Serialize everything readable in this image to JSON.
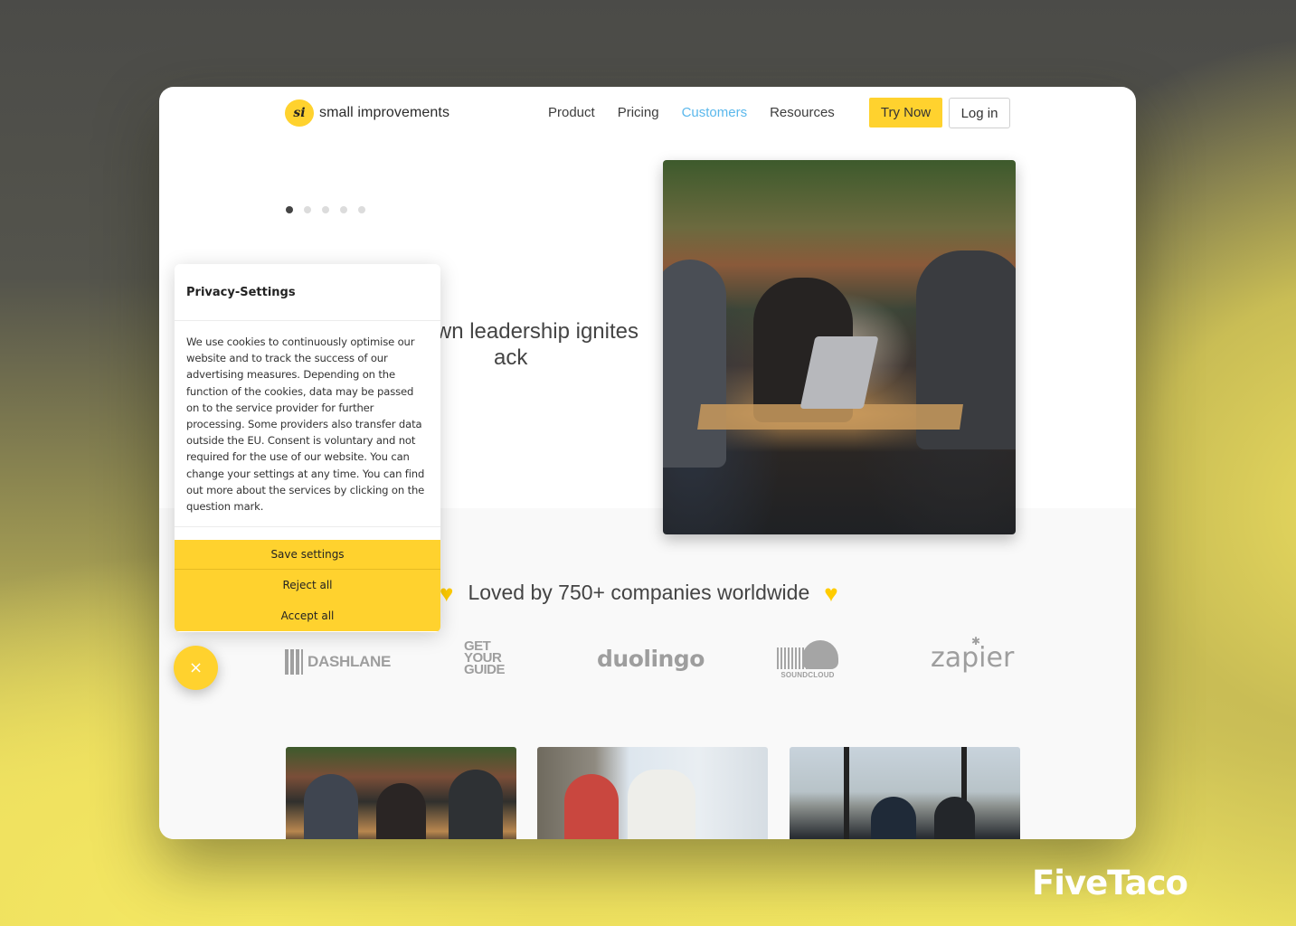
{
  "header": {
    "logo_mark": "si",
    "logo_text": "small improvements",
    "nav": [
      {
        "label": "Product",
        "active": false
      },
      {
        "label": "Pricing",
        "active": false
      },
      {
        "label": "Customers",
        "active": true
      },
      {
        "label": "Resources",
        "active": false
      }
    ],
    "try_now_label": "Try Now",
    "login_label": "Log in"
  },
  "carousel": {
    "slide_count": 5,
    "active_index": 0
  },
  "hero": {
    "headline_line1": "wn leadership ignites",
    "headline_line2": "ack",
    "image_icon": "photo-team-at-cafe-table"
  },
  "social_proof": {
    "heading": "Loved by 750+ companies worldwide",
    "heart_icon": "heart-icon",
    "logos": [
      {
        "name": "DASHLANE"
      },
      {
        "name": "GET YOUR GUIDE",
        "lines": [
          "GET",
          "YOUR",
          "GUIDE"
        ]
      },
      {
        "name": "duolingo"
      },
      {
        "name": "SOUNDCLOUD"
      },
      {
        "name": "zapier"
      }
    ]
  },
  "cards": [
    {
      "image": "team-at-cafe-photo"
    },
    {
      "image": "two-men-laughing-photo"
    },
    {
      "image": "city-skyline-office-photo"
    }
  ],
  "privacy": {
    "title": "Privacy-Settings",
    "body": "We use cookies to continuously optimise our website and to track the success of our advertising measures. Depending on the function of the cookies, data may be passed on to the service provider for further processing. Some providers also transfer data outside the EU. Consent is voluntary and not required for the use of our website. You can change your settings at any time. You can find out more about the services by clicking on the question mark.",
    "save_label": "Save settings",
    "reject_label": "Reject all",
    "accept_label": "Accept all"
  },
  "fab": {
    "close_glyph": "×"
  },
  "watermark": "FiveTaco",
  "colors": {
    "brand_yellow": "#ffd22e",
    "accent_blue": "#5bb8ec",
    "heart": "#ffcc00"
  }
}
